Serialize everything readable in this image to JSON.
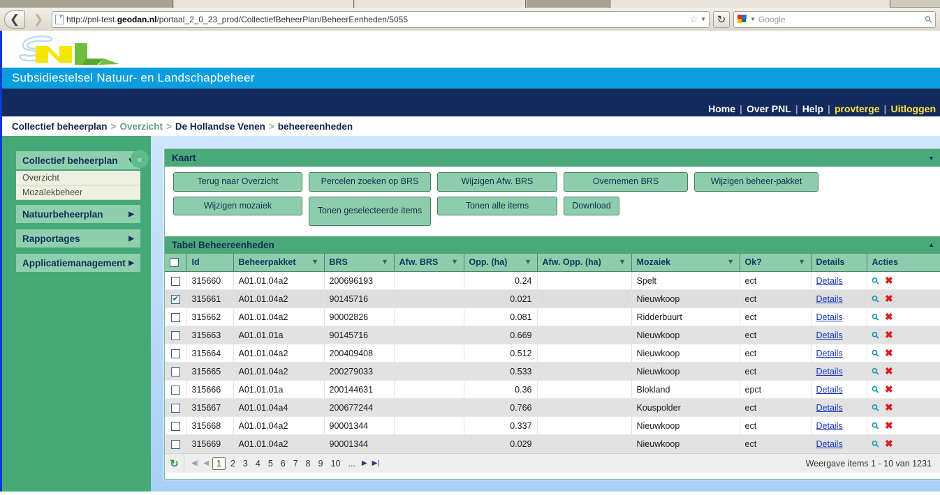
{
  "browser": {
    "url_prefix": "http://pnl-test.",
    "url_bold": "geodan.nl",
    "url_suffix": "/portaal_2_0_23_prod/CollectiefBeheerPlan/BeheerEenheden/5055",
    "search_placeholder": "Google",
    "back_icon": "back-arrow-icon",
    "forward_icon": "forward-arrow-icon",
    "reload_icon": "reload-icon",
    "star_icon": "bookmark-star-icon",
    "search_icon": "magnifier-icon"
  },
  "header": {
    "site_title": "Subsidiestelsel Natuur- en Landschapbeheer",
    "logo_alt": "snl-logo"
  },
  "topnav": {
    "items": [
      {
        "label": "Home",
        "highlight": false
      },
      {
        "label": "Over PNL",
        "highlight": false
      },
      {
        "label": "Help",
        "highlight": false
      },
      {
        "label": "provterge",
        "highlight": true
      },
      {
        "label": "Uitloggen",
        "highlight": true
      }
    ],
    "separator": "|"
  },
  "breadcrumb": {
    "separator": ">",
    "items": [
      {
        "label": "Collectief beheerplan",
        "muted": false
      },
      {
        "label": "Overzicht",
        "muted": true
      },
      {
        "label": "De Hollandse Venen",
        "muted": false
      },
      {
        "label": "beheereenheden",
        "muted": false
      }
    ]
  },
  "sidebar": {
    "collapse_label": "«",
    "groups": [
      {
        "label": "Collectief beheerplan",
        "arrow": "▼",
        "sub": [
          "Overzicht",
          "Mozaïekbeheer"
        ]
      },
      {
        "label": "Natuurbeheerplan",
        "arrow": "▶",
        "sub": []
      },
      {
        "label": "Rapportages",
        "arrow": "▶",
        "sub": []
      },
      {
        "label": "Applicatiemanagement",
        "arrow": "▶",
        "sub": []
      }
    ]
  },
  "kaart": {
    "title": "Kaart",
    "collapse_icon": "chevron-down-icon",
    "buttons_row1": [
      "Terug naar Overzicht",
      "Percelen zoeken op BRS",
      "Wijzigen Afw. BRS",
      "Overnemen BRS",
      "Wijzigen beheer-pakket"
    ],
    "buttons_row2": [
      "Wijzigen mozaiek",
      "Tonen geselecteerde items",
      "Tonen alle items",
      "Download"
    ]
  },
  "table": {
    "title": "Tabel Beheereenheden",
    "collapse_icon": "chevron-up-icon",
    "select_all_checked": false,
    "columns": [
      {
        "label": "",
        "filter": false
      },
      {
        "label": "Id",
        "filter": false
      },
      {
        "label": "Beheerpakket",
        "filter": true
      },
      {
        "label": "BRS",
        "filter": true
      },
      {
        "label": "Afw. BRS",
        "filter": true
      },
      {
        "label": "Opp. (ha)",
        "filter": true
      },
      {
        "label": "Afw. Opp. (ha)",
        "filter": true
      },
      {
        "label": "Mozaiek",
        "filter": true
      },
      {
        "label": "Ok?",
        "filter": true
      },
      {
        "label": "Details",
        "filter": false
      },
      {
        "label": "Acties",
        "filter": false
      }
    ],
    "details_label": "Details",
    "zoom_icon": "magnifier-icon",
    "delete_icon": "delete-x-icon",
    "rows": [
      {
        "checked": false,
        "id": "315660",
        "beheerpakket": "A01.01.04a2",
        "brs": "200696193",
        "afw_brs": "",
        "opp": "0.24",
        "afw_opp": "",
        "mozaiek": "Spelt",
        "ok": "ect"
      },
      {
        "checked": true,
        "id": "315661",
        "beheerpakket": "A01.01.04a2",
        "brs": "90145716",
        "afw_brs": "",
        "opp": "0.021",
        "afw_opp": "",
        "mozaiek": "Nieuwkoop",
        "ok": "ect"
      },
      {
        "checked": false,
        "id": "315662",
        "beheerpakket": "A01.01.04a2",
        "brs": "90002826",
        "afw_brs": "",
        "opp": "0.081",
        "afw_opp": "",
        "mozaiek": "Ridderbuurt",
        "ok": "ect"
      },
      {
        "checked": false,
        "id": "315663",
        "beheerpakket": "A01.01.01a",
        "brs": "90145716",
        "afw_brs": "",
        "opp": "0.669",
        "afw_opp": "",
        "mozaiek": "Nieuwkoop",
        "ok": "ect"
      },
      {
        "checked": false,
        "id": "315664",
        "beheerpakket": "A01.01.04a2",
        "brs": "200409408",
        "afw_brs": "",
        "opp": "0.512",
        "afw_opp": "",
        "mozaiek": "Nieuwkoop",
        "ok": "ect"
      },
      {
        "checked": false,
        "id": "315665",
        "beheerpakket": "A01.01.04a2",
        "brs": "200279033",
        "afw_brs": "",
        "opp": "0.533",
        "afw_opp": "",
        "mozaiek": "Nieuwkoop",
        "ok": "ect"
      },
      {
        "checked": false,
        "id": "315666",
        "beheerpakket": "A01.01.01a",
        "brs": "200144631",
        "afw_brs": "",
        "opp": "0.36",
        "afw_opp": "",
        "mozaiek": "Blokland",
        "ok": "epct"
      },
      {
        "checked": false,
        "id": "315667",
        "beheerpakket": "A01.01.04a4",
        "brs": "200677244",
        "afw_brs": "",
        "opp": "0.766",
        "afw_opp": "",
        "mozaiek": "Kouspolder",
        "ok": "ect"
      },
      {
        "checked": false,
        "id": "315668",
        "beheerpakket": "A01.01.04a2",
        "brs": "90001344",
        "afw_brs": "",
        "opp": "0.337",
        "afw_opp": "",
        "mozaiek": "Nieuwkoop",
        "ok": "ect"
      },
      {
        "checked": false,
        "id": "315669",
        "beheerpakket": "A01.01.04a2",
        "brs": "90001344",
        "afw_brs": "",
        "opp": "0.029",
        "afw_opp": "",
        "mozaiek": "Nieuwkoop",
        "ok": "ect"
      }
    ]
  },
  "pager": {
    "refresh_icon": "refresh-icon",
    "first": "⏮",
    "prev": "◂",
    "next": "▸",
    "last": "⏭",
    "pages": [
      "1",
      "2",
      "3",
      "4",
      "5",
      "6",
      "7",
      "8",
      "9",
      "10",
      "..."
    ],
    "current": "1",
    "summary": "Weergave items 1 - 10 van 1231"
  },
  "colors": {
    "brand_blue": "#0b9ede",
    "nav_navy": "#132a5c",
    "sidebar_green": "#44a977",
    "panel_green": "#4aa87a",
    "button_green": "#8ecdab",
    "link_blue": "#1535c0",
    "highlight_yellow": "#ffe23d",
    "delete_red": "#e01b1b"
  }
}
